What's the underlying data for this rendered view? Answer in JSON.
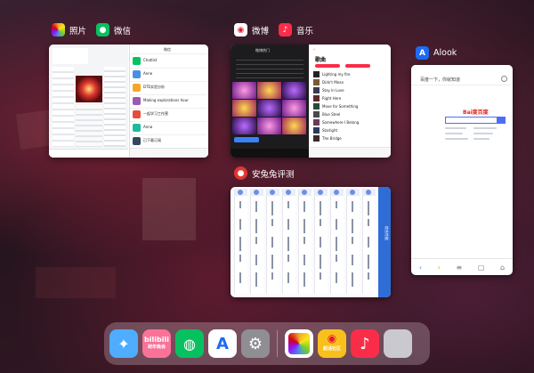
{
  "switcher": {
    "group1": {
      "apps": [
        "照片",
        "微信"
      ]
    },
    "group2": {
      "apps": [
        "微博",
        "音乐"
      ]
    },
    "group3": {
      "app": "Alook"
    },
    "group4": {
      "app": "安兔兔评测"
    }
  },
  "cards": {
    "wechat_title": "微信",
    "wechat_chats": [
      "Chatlist",
      "Anne",
      "DTE实验分析",
      "Making explorations hour",
      "一起学习工作营",
      "Anna",
      "已下载订阅"
    ],
    "weibo_title": "微博热门",
    "music_title": "歌曲",
    "music_tracks": [
      "Lighting my fire",
      "Didn't Mean",
      "Stay In Love",
      "Right Here",
      "Move for Something",
      "Blue Steel",
      "Somewhere I Belong",
      "Starlight",
      "The Bridge"
    ],
    "alook_search_hint": "百度一下，你就知道",
    "baidu_logo": "Bai度百度",
    "antutu_section": "综合性能"
  },
  "dock": {
    "left": [
      "safari-icon",
      "bilibili-icon",
      "wechat-icon",
      "alook-icon",
      "settings-icon"
    ],
    "right": [
      "photos-icon",
      "weibo-icon",
      "music-icon",
      "folder-icon"
    ],
    "bilibili_label": "bilibili",
    "bilibili_sub": "跨年晚会",
    "weibo_sub": "超话社区"
  },
  "colors": {
    "wechat": "#07C160",
    "music": "#FA2D48",
    "weibo": "#E6162D",
    "alook": "#1E6BF1",
    "bilibili": "#FB7299",
    "antutu": "#2F6DD6"
  }
}
